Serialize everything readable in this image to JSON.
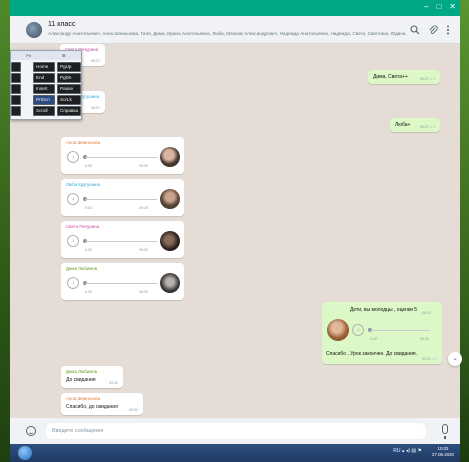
{
  "window": {
    "controls": [
      "–",
      "□",
      "✕"
    ]
  },
  "header": {
    "title": "11 класс",
    "members": "Александр Анатольевич, Анна Шпинькова, Галя, Дима, Ирина Анатольевна, Люба, Максим Александрович, Надежда Анатольевна, Надежда, Света, Светлана, Юдина, Вы",
    "search_icon": "search-icon",
    "attach_icon": "paperclip-icon",
    "menu_icon": "more-vertical-icon"
  },
  "messages": {
    "m1": {
      "sender": "Света Печурина",
      "time": "09:27"
    },
    "m2": {
      "text": "Дима, Света++",
      "time": "09:27",
      "ticks": "✓✓"
    },
    "m3": {
      "sender": "Люба Кругушина",
      "time": "09:27"
    },
    "m4": {
      "text": "Люба+",
      "time": "09:27",
      "ticks": "✓✓"
    },
    "v1": {
      "sender": "Анна Шпинькова",
      "duration": "0:05",
      "time": "09:29"
    },
    "v2": {
      "sender": "Люба Кругушина",
      "duration": "0:04",
      "time": "09:29"
    },
    "v3": {
      "sender": "Света Печурина",
      "duration": "0:03",
      "time": "09:30"
    },
    "v4": {
      "sender": "Дима Любимов",
      "duration": "0:04",
      "time": "09:30"
    },
    "o1": {
      "text1": "Дети, вы молодцы , оценки 5",
      "time1": "09:31",
      "duration": "0:12",
      "time2": "09:31",
      "text2": "Спасибо , Урок закончен. До свидания.",
      "time3": "09:31",
      "ticks": "✓✓"
    },
    "r1": {
      "sender": "Дима Любимов",
      "text": "До свидания",
      "time": "09:32"
    },
    "r2": {
      "sender": "Анна Шпинькова",
      "text": "Спасибо, до свидания",
      "time": "09:32"
    }
  },
  "composer": {
    "placeholder": "Введите сообщение"
  },
  "osk": {
    "title": [
      "Fn",
      "☰"
    ],
    "keys": [
      "Home",
      "PgUp",
      "End",
      "PgDn",
      "Insert",
      "Pause",
      "PrtScn",
      "ScrLk",
      "Scroll",
      "Справка"
    ]
  },
  "taskbar": {
    "lang": "RU",
    "time": "10:03",
    "date": "27.06.2020"
  },
  "colors": {
    "brand": "#00a884",
    "outgoing": "#dcf8c6",
    "incoming": "#ffffff",
    "chat_bg": "#e5ddd5",
    "sender_orange": "#e67a3a",
    "sender_blue": "#35a6d6",
    "sender_pink": "#c44a9e",
    "sender_green": "#6a9b1b"
  }
}
